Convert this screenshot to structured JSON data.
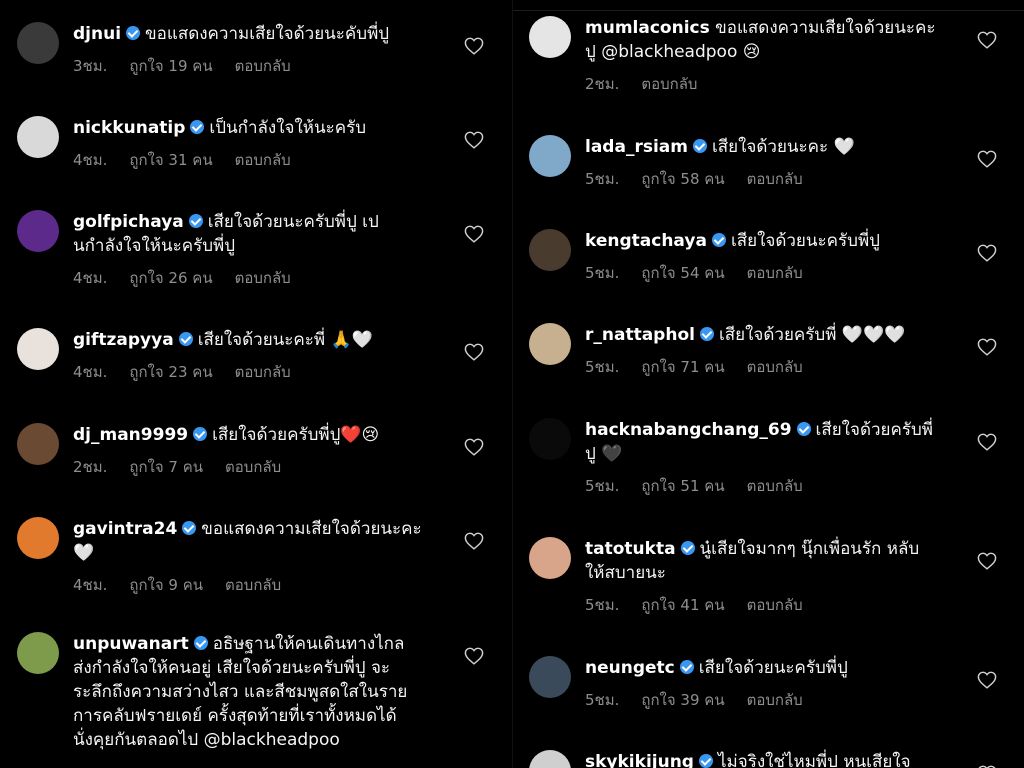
{
  "left": [
    {
      "user": "djnui",
      "verified": true,
      "text": "ขอแสดงความเสียใจด้วยนะคับพี่ปู",
      "time": "3ชม.",
      "likes": "ถูกใจ 19 คน",
      "reply": "ตอบกลับ",
      "avatar": "#3a3a3a"
    },
    {
      "user": "nickkunatip",
      "verified": true,
      "text": "เป็นกำลังใจให้นะครับ",
      "time": "4ชม.",
      "likes": "ถูกใจ 31 คน",
      "reply": "ตอบกลับ",
      "avatar": "#d9d9d9"
    },
    {
      "user": "golfpichaya",
      "verified": true,
      "text": "เสียใจด้วยนะครับพี่ปู เป\nนกำลังใจให้นะครับพี่ปู",
      "time": "4ชม.",
      "likes": "ถูกใจ 26 คน",
      "reply": "ตอบกลับ",
      "avatar": "#5b2a8a"
    },
    {
      "user": "giftzapyya",
      "verified": true,
      "text": "เสียใจด้วยนะคะพี่ 🙏🤍",
      "time": "4ชม.",
      "likes": "ถูกใจ 23 คน",
      "reply": "ตอบกลับ",
      "avatar": "#e9e2dc"
    },
    {
      "user": "dj_man9999",
      "verified": true,
      "text": "เสียใจด้วยครับพี่ปู❤️😢",
      "time": "2ชม.",
      "likes": "ถูกใจ 7 คน",
      "reply": "ตอบกลับ",
      "avatar": "#6b4a33"
    },
    {
      "user": "gavintra24",
      "verified": true,
      "text": "ขอแสดงความเสียใจด้วยนะคะ\n🤍",
      "time": "4ชม.",
      "likes": "ถูกใจ 9 คน",
      "reply": "ตอบกลับ",
      "avatar": "#e27a2e"
    },
    {
      "user": "unpuwanart",
      "verified": true,
      "text": "อธิษฐานให้คนเดินทางไกล\nส่งกำลังใจให้คนอยู่ เสียใจด้วยนะครับพี่ปู จะ\nระลึกถึงความสว่างไสว และสีชมพูสดใสในราย\nการคลับฟรายเดย์ ครั้งสุดท้ายที่เราทั้งหมดได้\nนั่งคุยกันตลอดไป @blackheadpoo",
      "time": "",
      "likes": "",
      "reply": "",
      "avatar": "#7d9b4a"
    }
  ],
  "right": [
    {
      "user": "mumlaconics",
      "verified": false,
      "text": "ขอแสดงความเสียใจด้วยนะคะ\nปู @blackheadpoo 😢",
      "time": "2ชม.",
      "likes": "",
      "reply": "ตอบกลับ",
      "avatar": "#e5e5e5"
    },
    {
      "user": "lada_rsiam",
      "verified": true,
      "text": "เสียใจด้วยนะคะ 🤍",
      "time": "5ชม.",
      "likes": "ถูกใจ 58 คน",
      "reply": "ตอบกลับ",
      "avatar": "#7fa8c9"
    },
    {
      "user": "kengtachaya",
      "verified": true,
      "text": "เสียใจด้วยนะครับพี่ปู",
      "time": "5ชม.",
      "likes": "ถูกใจ 54 คน",
      "reply": "ตอบกลับ",
      "avatar": "#4a3b2f"
    },
    {
      "user": "r_nattaphol",
      "verified": true,
      "text": "เสียใจด้วยครับพี่ 🤍🤍🤍",
      "time": "5ชม.",
      "likes": "ถูกใจ 71 คน",
      "reply": "ตอบกลับ",
      "avatar": "#c7b08f"
    },
    {
      "user": "hacknabangchang_69",
      "verified": true,
      "text": "เสียใจด้วยครับพี่\nปู 🖤",
      "time": "5ชม.",
      "likes": "ถูกใจ 51 คน",
      "reply": "ตอบกลับ",
      "avatar": "#0a0a0a"
    },
    {
      "user": "tatotukta",
      "verified": true,
      "text": "นู๋เสียใจมากๆ นุ๊กเพื่อนรัก หลับ\nให้สบายนะ",
      "time": "5ชม.",
      "likes": "ถูกใจ 41 คน",
      "reply": "ตอบกลับ",
      "avatar": "#d9a58a"
    },
    {
      "user": "neungetc",
      "verified": true,
      "text": "เสียใจด้วยนะครับพี่ปู",
      "time": "5ชม.",
      "likes": "ถูกใจ 39 คน",
      "reply": "ตอบกลับ",
      "avatar": "#3b4a5a"
    },
    {
      "user": "skykikijung",
      "verified": true,
      "text": "ไม่จริงใช่ไหมพี่ปู หนูเสียใจ",
      "time": "",
      "likes": "",
      "reply": "",
      "avatar": "#cfcfcf"
    }
  ],
  "icons": {
    "heart": "heart-outline-icon",
    "verified": "verified-badge-icon"
  }
}
